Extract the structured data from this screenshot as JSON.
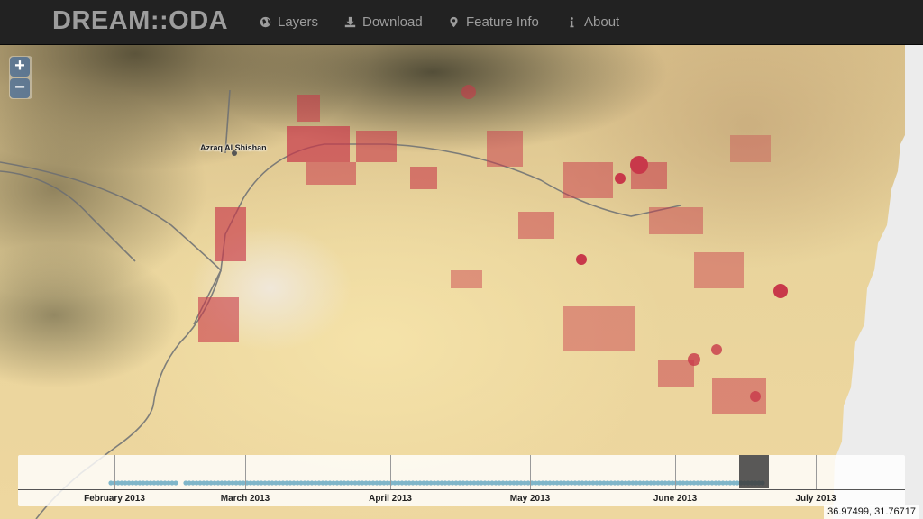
{
  "navbar": {
    "brand": "DREAM::ODA",
    "items": [
      {
        "label": "Layers",
        "icon": "globe-icon"
      },
      {
        "label": "Download",
        "icon": "download-icon"
      },
      {
        "label": "Feature Info",
        "icon": "map-marker-icon"
      },
      {
        "label": "About",
        "icon": "info-icon"
      }
    ]
  },
  "map": {
    "place_label": "Azraq Al Shishan",
    "zoom_in": "+",
    "zoom_out": "−"
  },
  "timeline": {
    "months": [
      "February 2013",
      "March 2013",
      "April 2013",
      "May 2013",
      "June 2013",
      "July 2013"
    ]
  },
  "coordinates": "36.97499, 31.76717",
  "colors": {
    "navbar_bg": "#222222",
    "nav_text": "#9d9d9d",
    "vegetation_red": "#d23c46",
    "timeline_dot": "#7fb6c9"
  }
}
